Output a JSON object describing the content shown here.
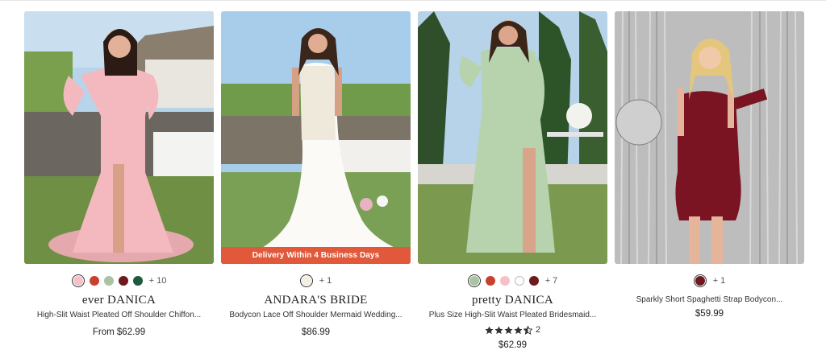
{
  "products": [
    {
      "brand": "ever DANICA",
      "title": "High-Slit Waist Pleated Off Shoulder Chiffon...",
      "price": "From $62.99",
      "swatches": [
        "#f6c0c8",
        "#c8412e",
        "#a9c4a3",
        "#6d1a1c",
        "#1f5a3d"
      ],
      "selected_swatch": 0,
      "more_colors": "+ 10",
      "image_alt": "pink off-shoulder chiffon gown"
    },
    {
      "brand": "ANDARA'S BRIDE",
      "title": "Bodycon Lace Off Shoulder Mermaid Wedding...",
      "price": "$86.99",
      "swatches": [
        "#f2efe2"
      ],
      "selected_swatch": 0,
      "more_colors": "+ 1",
      "promo_banner": "Delivery Within 4 Business Days",
      "image_alt": "white lace mermaid wedding gown"
    },
    {
      "brand": "pretty DANICA",
      "title": "Plus Size High-Slit Waist Pleated Bridesmaid...",
      "price": "$62.99",
      "swatches": [
        "#a9c4a3",
        "#c8412e",
        "#f6c0c8",
        "#ffffff",
        "#6d1a1c"
      ],
      "selected_swatch": 0,
      "more_colors": "+ 7",
      "rating": 4.5,
      "rating_count": "2",
      "image_alt": "sage green plus size bridesmaid gown"
    },
    {
      "brand": "",
      "title": "Sparkly Short Spaghetti Strap Bodycon...",
      "price": "$59.99",
      "swatches": [
        "#6d1a1c"
      ],
      "selected_swatch": 0,
      "more_colors": "+ 1",
      "image_alt": "burgundy sequin mini dress"
    }
  ],
  "icons": {
    "star": "star-icon",
    "promo": "delivery-banner"
  }
}
